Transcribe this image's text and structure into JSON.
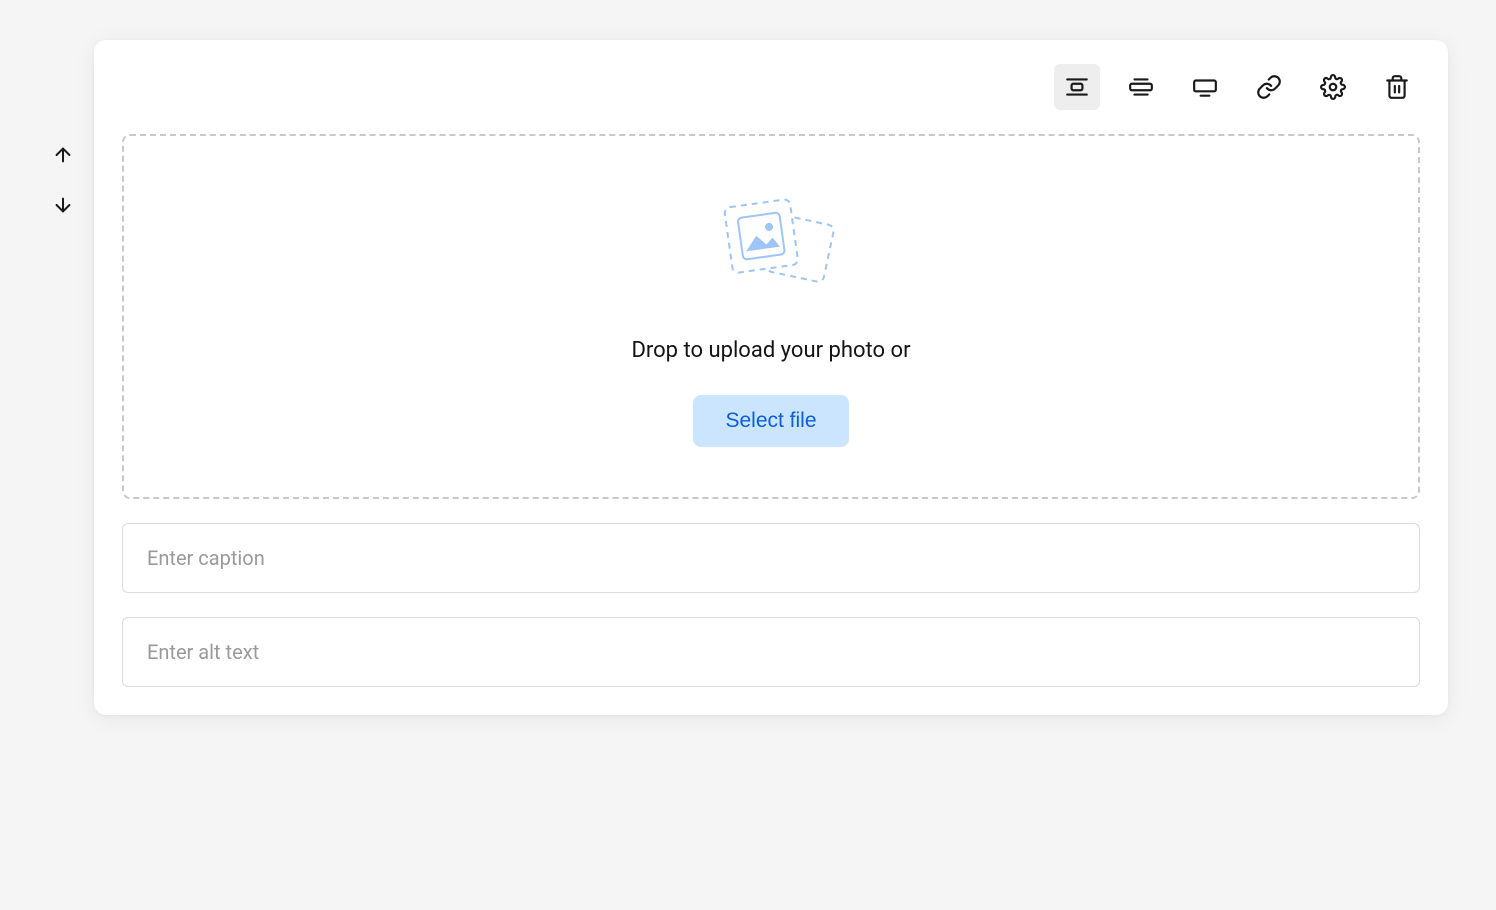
{
  "dropzone": {
    "prompt": "Drop to upload your photo or",
    "button_label": "Select file"
  },
  "inputs": {
    "caption_placeholder": "Enter caption",
    "alt_text_placeholder": "Enter alt text"
  }
}
